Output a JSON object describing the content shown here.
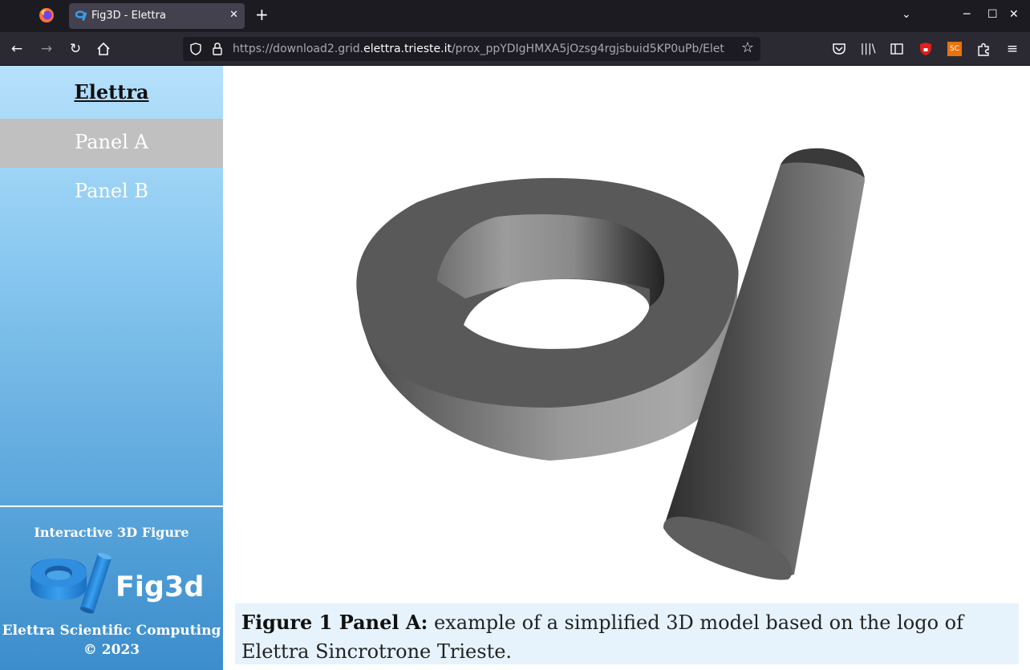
{
  "browser": {
    "tab_title": "Fig3D - Elettra",
    "tab_close": "✕",
    "new_tab": "+",
    "url_prefix": "https://download2.grid.",
    "url_host": "elettra.trieste.it",
    "url_path": "/prox_ppYDIgHMXA5jOzsg4rgjsbuid5KP0uPb/Elet",
    "extension_badge": "SC"
  },
  "sidebar": {
    "title": "Elettra",
    "items": [
      {
        "label": "Panel A",
        "selected": true
      },
      {
        "label": "Panel B",
        "selected": false
      }
    ],
    "footer_title": "Interactive 3D Figure",
    "logo_text": "Fig3d",
    "org": "Elettra Scientific Computing",
    "copyright": "© 2023"
  },
  "caption": {
    "label": "Figure 1 Panel A:",
    "text": " example of a simplified 3D model based on the logo of Elettra Sincrotrone Trieste."
  },
  "colors": {
    "chrome_dark": "#1c1b22",
    "chrome_nav": "#2b2a33",
    "selected_item": "#c0c0c0",
    "caption_bg": "#e6f3fc",
    "model_gray": "#666666"
  }
}
